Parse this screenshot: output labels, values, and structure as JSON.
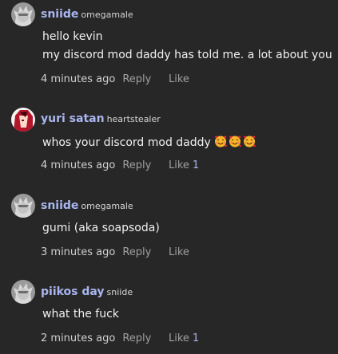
{
  "comments": [
    {
      "username": "sniide",
      "handle": "omegamale",
      "lines": [
        "hello kevin",
        "my discord mod daddy has told me. a lot about you"
      ],
      "time": "4 minutes ago",
      "reply_label": "Reply",
      "like_label": "Like",
      "like_count": ""
    },
    {
      "username": "yuri satan",
      "handle": "heartstealer",
      "lines": [
        "whos your discord mod daddy"
      ],
      "emojis": [
        "smiling-face-with-hearts",
        "smiling-face-with-hearts",
        "smiling-face-with-hearts"
      ],
      "time": "4 minutes ago",
      "reply_label": "Reply",
      "like_label": "Like",
      "like_count": "1"
    },
    {
      "username": "sniide",
      "handle": "omegamale",
      "lines": [
        "gumi (aka soapsoda)"
      ],
      "time": "3 minutes ago",
      "reply_label": "Reply",
      "like_label": "Like",
      "like_count": ""
    },
    {
      "username": "piikos day",
      "handle": "sniide",
      "lines": [
        "what the fuck"
      ],
      "time": "2 minutes ago",
      "reply_label": "Reply",
      "like_label": "Like",
      "like_count": "1"
    }
  ],
  "colors": {
    "background": "#272727",
    "username": "#aab6ef",
    "like_count": "#a8b4ee"
  }
}
